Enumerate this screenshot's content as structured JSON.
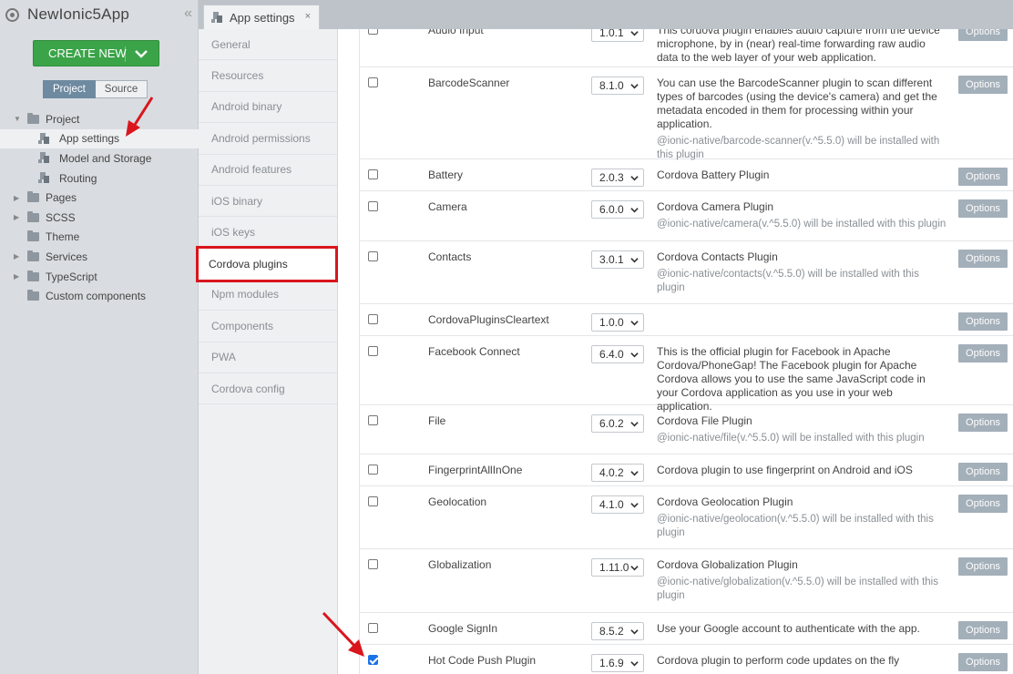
{
  "app": {
    "title": "NewIonic5App"
  },
  "create_button": {
    "label": "CREATE NEW"
  },
  "panel_tabs": [
    {
      "label": "Project"
    },
    {
      "label": "Source"
    }
  ],
  "tree": [
    {
      "label": "Project",
      "icon": "folder-icon",
      "expanded": true
    },
    {
      "label": "App settings",
      "icon": "page-icon",
      "selected": true
    },
    {
      "label": "Model and Storage",
      "icon": "page-icon"
    },
    {
      "label": "Routing",
      "icon": "page-icon"
    },
    {
      "label": "Pages",
      "icon": "folder-icon"
    },
    {
      "label": "SCSS",
      "icon": "folder-icon"
    },
    {
      "label": "Theme",
      "icon": "folder-icon"
    },
    {
      "label": "Services",
      "icon": "folder-icon"
    },
    {
      "label": "TypeScript",
      "icon": "folder-icon"
    },
    {
      "label": "Custom components",
      "icon": "folder-icon"
    }
  ],
  "doc_tab": {
    "title": "App settings",
    "close": "×"
  },
  "settings_nav": [
    {
      "label": "General"
    },
    {
      "label": "Resources"
    },
    {
      "label": "Android binary"
    },
    {
      "label": "Android permissions"
    },
    {
      "label": "Android features"
    },
    {
      "label": "iOS binary"
    },
    {
      "label": "iOS keys"
    },
    {
      "label": "Cordova plugins",
      "active": true
    },
    {
      "label": "Npm modules"
    },
    {
      "label": "Components"
    },
    {
      "label": "PWA"
    },
    {
      "label": "Cordova config"
    }
  ],
  "options_label": "Options",
  "plugins": [
    {
      "name": "Audio Input",
      "version": "1.0.1",
      "checked": false,
      "desc": "This cordova plugin enables audio capture from the device microphone, by in (near) real-time forwarding raw audio data to the web layer of your web application.",
      "note": ""
    },
    {
      "name": "BarcodeScanner",
      "version": "8.1.0",
      "checked": false,
      "desc": "You can use the BarcodeScanner plugin to scan different types of barcodes (using the device's camera) and get the metadata encoded in them for processing within your application.",
      "note": "@ionic-native/barcode-scanner(v.^5.5.0) will be installed with this plugin"
    },
    {
      "name": "Battery",
      "version": "2.0.3",
      "checked": false,
      "desc": "Cordova Battery Plugin",
      "note": ""
    },
    {
      "name": "Camera",
      "version": "6.0.0",
      "checked": false,
      "desc": "Cordova Camera Plugin",
      "note": "@ionic-native/camera(v.^5.5.0) will be installed with this plugin"
    },
    {
      "name": "Contacts",
      "version": "3.0.1",
      "checked": false,
      "desc": "Cordova Contacts Plugin",
      "note": "@ionic-native/contacts(v.^5.5.0) will be installed with this plugin"
    },
    {
      "name": "CordovaPluginsCleartext",
      "version": "1.0.0",
      "checked": false,
      "desc": "",
      "note": ""
    },
    {
      "name": "Facebook Connect",
      "version": "6.4.0",
      "checked": false,
      "desc": "This is the official plugin for Facebook in Apache Cordova/PhoneGap! The Facebook plugin for Apache Cordova allows you to use the same JavaScript code in your Cordova application as you use in your web application.",
      "note": ""
    },
    {
      "name": "File",
      "version": "6.0.2",
      "checked": false,
      "desc": "Cordova File Plugin",
      "note": "@ionic-native/file(v.^5.5.0) will be installed with this plugin"
    },
    {
      "name": "FingerprintAllInOne",
      "version": "4.0.2",
      "checked": false,
      "desc": "Cordova plugin to use fingerprint on Android and iOS",
      "note": ""
    },
    {
      "name": "Geolocation",
      "version": "4.1.0",
      "checked": false,
      "desc": "Cordova Geolocation Plugin",
      "note": "@ionic-native/geolocation(v.^5.5.0) will be installed with this plugin"
    },
    {
      "name": "Globalization",
      "version": "1.11.0",
      "checked": false,
      "desc": "Cordova Globalization Plugin",
      "note": "@ionic-native/globalization(v.^5.5.0) will be installed with this plugin"
    },
    {
      "name": "Google SignIn",
      "version": "8.5.2",
      "checked": false,
      "desc": "Use your Google account to authenticate with the app.",
      "note": ""
    },
    {
      "name": "Hot Code Push Plugin",
      "version": "1.6.9",
      "checked": true,
      "desc": "Cordova plugin to perform code updates on the fly",
      "note": ""
    }
  ],
  "colors": {
    "create_green": "#3ba449",
    "highlight_red": "#d9161d",
    "options_gray": "#a3afb9",
    "tab_active": "#6e8aa0"
  }
}
